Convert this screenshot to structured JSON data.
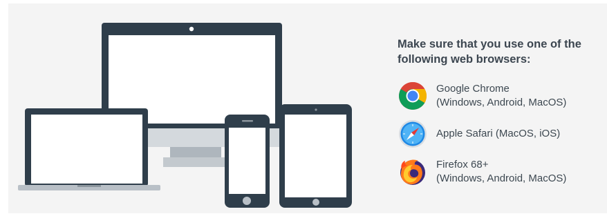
{
  "info": {
    "heading_line1": "Make sure that you use one of the",
    "heading_line2": "following web browsers:"
  },
  "browsers": [
    {
      "icon": "chrome-icon",
      "name_line1": "Google Chrome",
      "name_line2": "(Windows, Android, MacOS)"
    },
    {
      "icon": "safari-icon",
      "name_line1": "Apple Safari (MacOS, iOS)",
      "name_line2": ""
    },
    {
      "icon": "firefox-icon",
      "name_line1": "Firefox 68+",
      "name_line2": "(Windows, Android, MacOS)"
    }
  ],
  "colors": {
    "panel_bg": "#f4f4f4",
    "device_dark": "#2f3e4b",
    "screen": "#ffffff",
    "metal": "#b9c0c7",
    "text": "#3d4851"
  }
}
